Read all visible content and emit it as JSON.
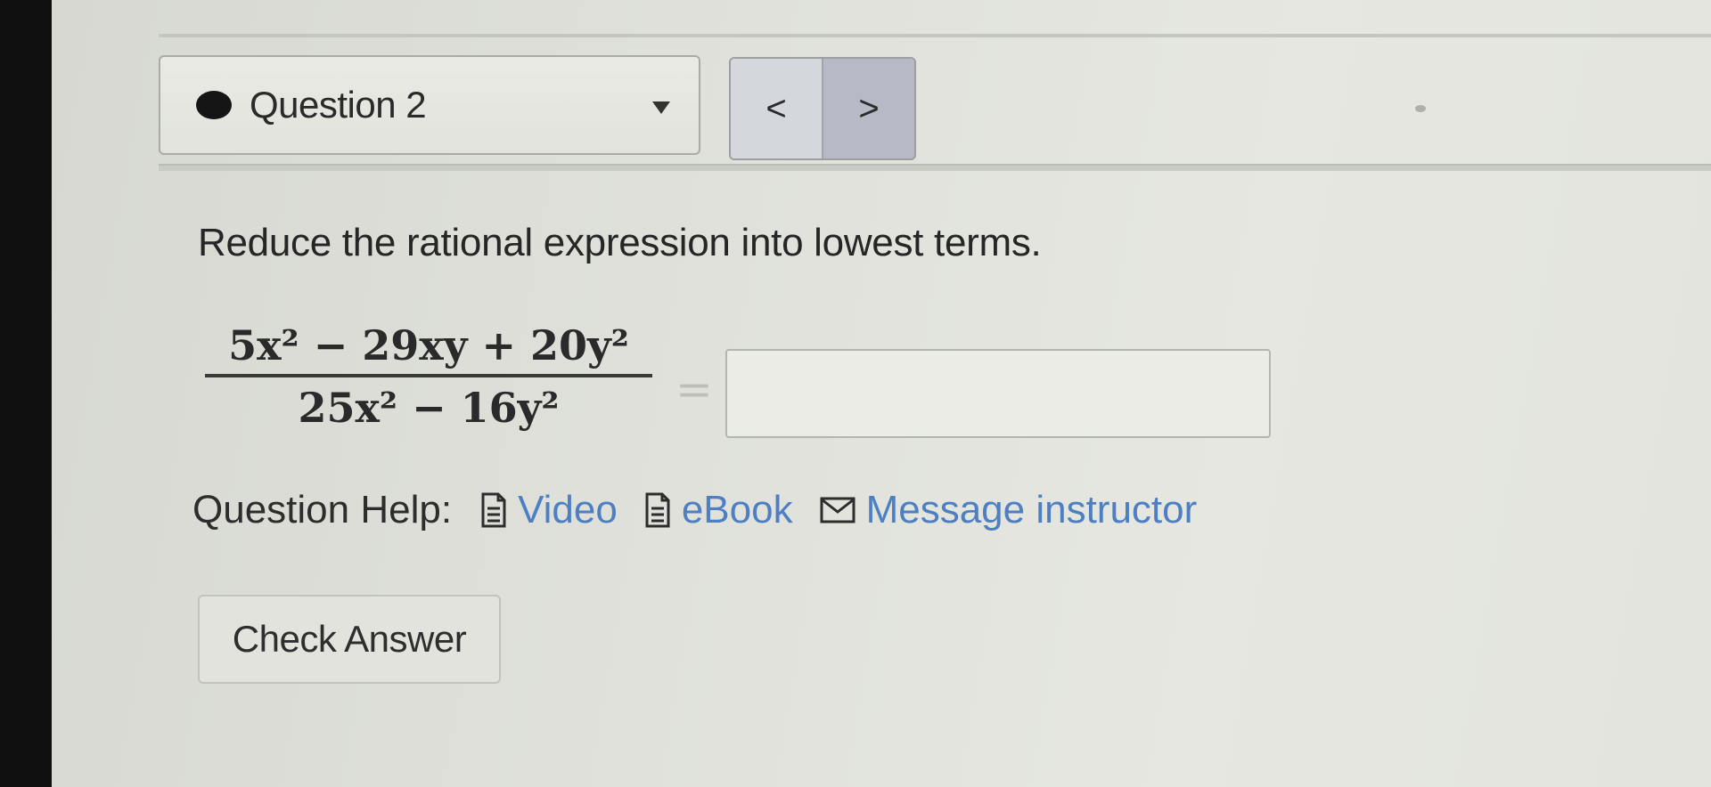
{
  "question_nav": {
    "current_label": "Question 2",
    "prev_symbol": "<",
    "next_symbol": ">"
  },
  "question": {
    "prompt": "Reduce the rational expression into lowest terms.",
    "expression": {
      "numerator": "5x² − 29xy + 20y²",
      "denominator": "25x² − 16y²",
      "equals": "="
    },
    "answer_value": ""
  },
  "help": {
    "label": "Question Help:",
    "links": [
      {
        "label": "Video",
        "icon": "document-icon"
      },
      {
        "label": "eBook",
        "icon": "document-icon"
      },
      {
        "label": "Message instructor",
        "icon": "envelope-icon"
      }
    ]
  },
  "actions": {
    "check_label": "Check Answer"
  },
  "colors": {
    "link": "#4d7fc2",
    "next_button_bg": "#b7b9c6",
    "prev_button_bg": "#d4d7dc"
  }
}
